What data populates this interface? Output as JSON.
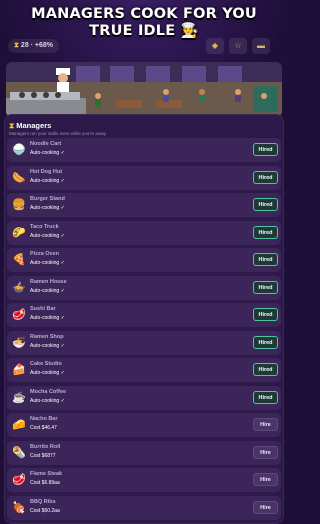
{
  "header": {
    "title_line1": "MANAGERS COOK FOR YOU",
    "title_line2": "TRUE IDLE 🧑‍🍳"
  },
  "topbar": {
    "stat_text": "28 · +68%",
    "stat_icon": "hourglass-icon",
    "buttons": [
      "shield-icon",
      "trophy-icon",
      "menu-icon"
    ]
  },
  "panel": {
    "title": "Managers",
    "subtitle": "Managers run your stalls even while you're away"
  },
  "managers": [
    {
      "emoji": "🍚",
      "name": "Noodle Cart",
      "sub": "Auto-cooking ✓",
      "action": "Hired",
      "hired": true
    },
    {
      "emoji": "🌭",
      "name": "Hot Dog Hut",
      "sub": "Auto-cooking ✓",
      "action": "Hired",
      "hired": true
    },
    {
      "emoji": "🍔",
      "name": "Burger Stand",
      "sub": "Auto-cooking ✓",
      "action": "Hired",
      "hired": true
    },
    {
      "emoji": "🌮",
      "name": "Taco Truck",
      "sub": "Auto-cooking ✓",
      "action": "Hired",
      "hired": true
    },
    {
      "emoji": "🍕",
      "name": "Pizza Oven",
      "sub": "Auto-cooking ✓",
      "action": "Hired",
      "hired": true
    },
    {
      "emoji": "🍲",
      "name": "Ramen House",
      "sub": "Auto-cooking ✓",
      "action": "Hired",
      "hired": true
    },
    {
      "emoji": "🥩",
      "name": "Sushi Bar",
      "sub": "Auto-cooking ✓",
      "action": "Hired",
      "hired": true
    },
    {
      "emoji": "🍜",
      "name": "Ramen Shop",
      "sub": "Auto-cooking ✓",
      "action": "Hired",
      "hired": true
    },
    {
      "emoji": "🍰",
      "name": "Cake Studio",
      "sub": "Auto-cooking ✓",
      "action": "Hired",
      "hired": true
    },
    {
      "emoji": "☕",
      "name": "Mocha Coffee",
      "sub": "Auto-cooking ✓",
      "action": "Hired",
      "hired": true
    },
    {
      "emoji": "🧀",
      "name": "Nacho Bar",
      "sub": "Cost $46.47",
      "action": "Hire",
      "hired": false
    },
    {
      "emoji": "🌯",
      "name": "Burrito Roll",
      "sub": "Cost $6877",
      "action": "Hire",
      "hired": false
    },
    {
      "emoji": "🥩",
      "name": "Flame Steak",
      "sub": "Cost $6.89aa",
      "action": "Hire",
      "hired": false
    },
    {
      "emoji": "🍖",
      "name": "BBQ Ribs",
      "sub": "Cost $60.2aa",
      "action": "Hire",
      "hired": false
    }
  ]
}
